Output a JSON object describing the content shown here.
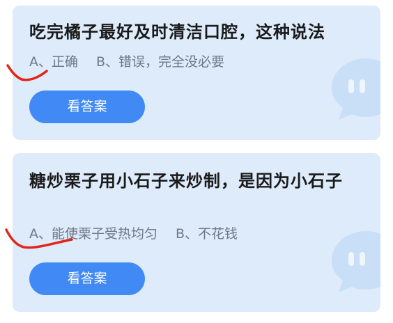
{
  "questions": [
    {
      "title": "吃完橘子最好及时清洁口腔，这种说法",
      "option_a": "A、正确",
      "option_b": "B、错误，完全没必要",
      "button_label": "看答案"
    },
    {
      "title": "糖炒栗子用小石子来炒制，是因为小石子",
      "option_a": "A、能使栗子受热均匀",
      "option_b": "B、不花钱",
      "button_label": "看答案"
    }
  ],
  "colors": {
    "card_bg": "#deebfa",
    "button_bg": "#4189f5",
    "title_text": "#1a1a1a",
    "option_text": "#6f7785",
    "annotation_red": "#e0251b",
    "chat_bubble": "#c9def7"
  }
}
